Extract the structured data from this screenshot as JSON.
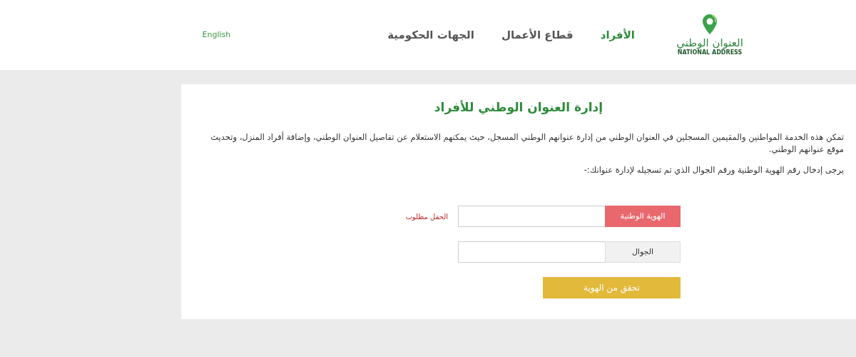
{
  "logo": {
    "name_ar": "العنوان الوطني",
    "name_en": "NATIONAL ADDRESS"
  },
  "nav": [
    {
      "label": "الأفراد",
      "selected": true
    },
    {
      "label": "قطاع الأعمال",
      "selected": false
    },
    {
      "label": "الجهات الحكومية",
      "selected": false
    }
  ],
  "language_link": "English",
  "title": "إدارة العنوان الوطني للأفراد",
  "intro": "تمكن هذه الخدمة المواطنين والمقيمين المسجلين في العنوان الوطني من إدارة عنوانهم الوطني المسجل، حيث يمكنهم الاستعلام عن تفاصيل العنوان الوطني، وإضافة أفراد المنزل، وتحديث موقع عنوانهم الوطني.",
  "instruction": "يرجى إدخال رقم الهوية الوطنية ورقم الجوال الذي تم تسجيله لإدارة عنوانك:-",
  "fields": [
    {
      "label": "الهوية الوطنية",
      "invalid": true,
      "error": "الحقل مطلوب"
    },
    {
      "label": "الجوال",
      "invalid": false
    }
  ],
  "submit": "تحقق من الهوية"
}
